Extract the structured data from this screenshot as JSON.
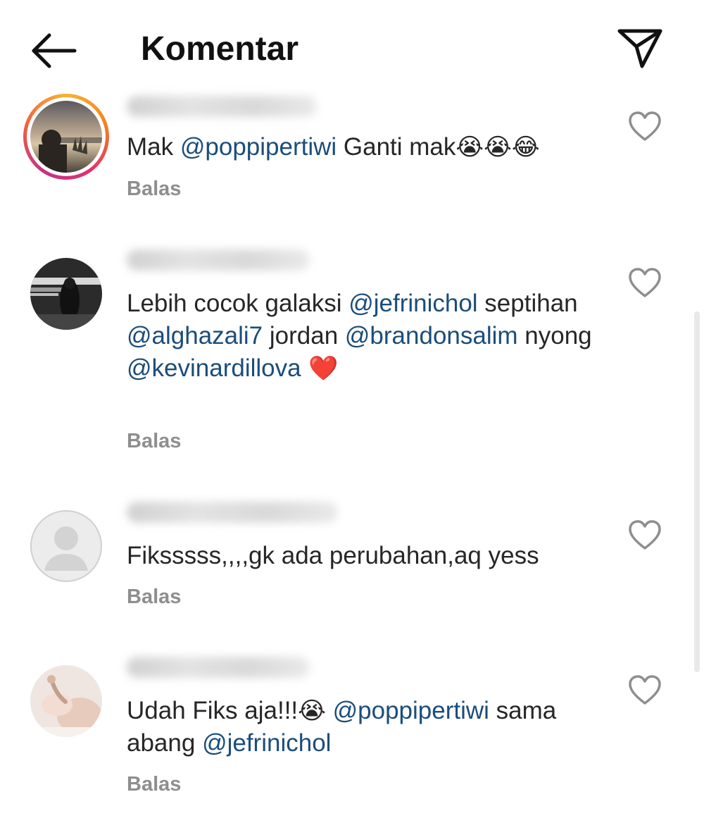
{
  "header": {
    "title": "Komentar",
    "back_icon": "arrow-left-icon",
    "send_icon": "paper-plane-icon"
  },
  "comments": [
    {
      "segments": [
        {
          "t": "Mak ",
          "m": false
        },
        {
          "t": "@poppipertiwi",
          "m": true
        },
        {
          "t": "  Ganti mak",
          "m": false
        },
        {
          "t": "😭😭😂",
          "m": false,
          "e": true
        }
      ],
      "reply_label": "Balas",
      "has_story_ring": true
    },
    {
      "segments": [
        {
          "t": "Lebih cocok galaksi ",
          "m": false
        },
        {
          "t": "@jefrinichol",
          "m": true
        },
        {
          "t": " septihan ",
          "m": false
        },
        {
          "t": "@alghazali7",
          "m": true
        },
        {
          "t": " jordan ",
          "m": false
        },
        {
          "t": "@brandonsalim",
          "m": true
        },
        {
          "t": " nyong ",
          "m": false
        },
        {
          "t": "@kevinardillova",
          "m": true
        },
        {
          "t": " ❤️",
          "m": false,
          "e": true
        }
      ],
      "reply_label": "Balas",
      "has_story_ring": false
    },
    {
      "segments": [
        {
          "t": "Fiksssss,,,,gk ada perubahan,aq yess",
          "m": false
        }
      ],
      "reply_label": "Balas",
      "has_story_ring": false
    },
    {
      "segments": [
        {
          "t": "Udah Fiks aja!!!",
          "m": false
        },
        {
          "t": "😭",
          "m": false,
          "e": true
        },
        {
          "t": " ",
          "m": false
        },
        {
          "t": "@poppipertiwi",
          "m": true
        },
        {
          "t": " sama abang ",
          "m": false
        },
        {
          "t": "@jefrinichol",
          "m": true
        }
      ],
      "reply_label": "Balas",
      "has_story_ring": false
    }
  ],
  "colors": {
    "mention": "#1b4d7a",
    "reply": "#8e8e8e",
    "text": "#262626"
  },
  "icons": {
    "like": "heart-outline-icon",
    "default_avatar": "person-silhouette-icon"
  }
}
